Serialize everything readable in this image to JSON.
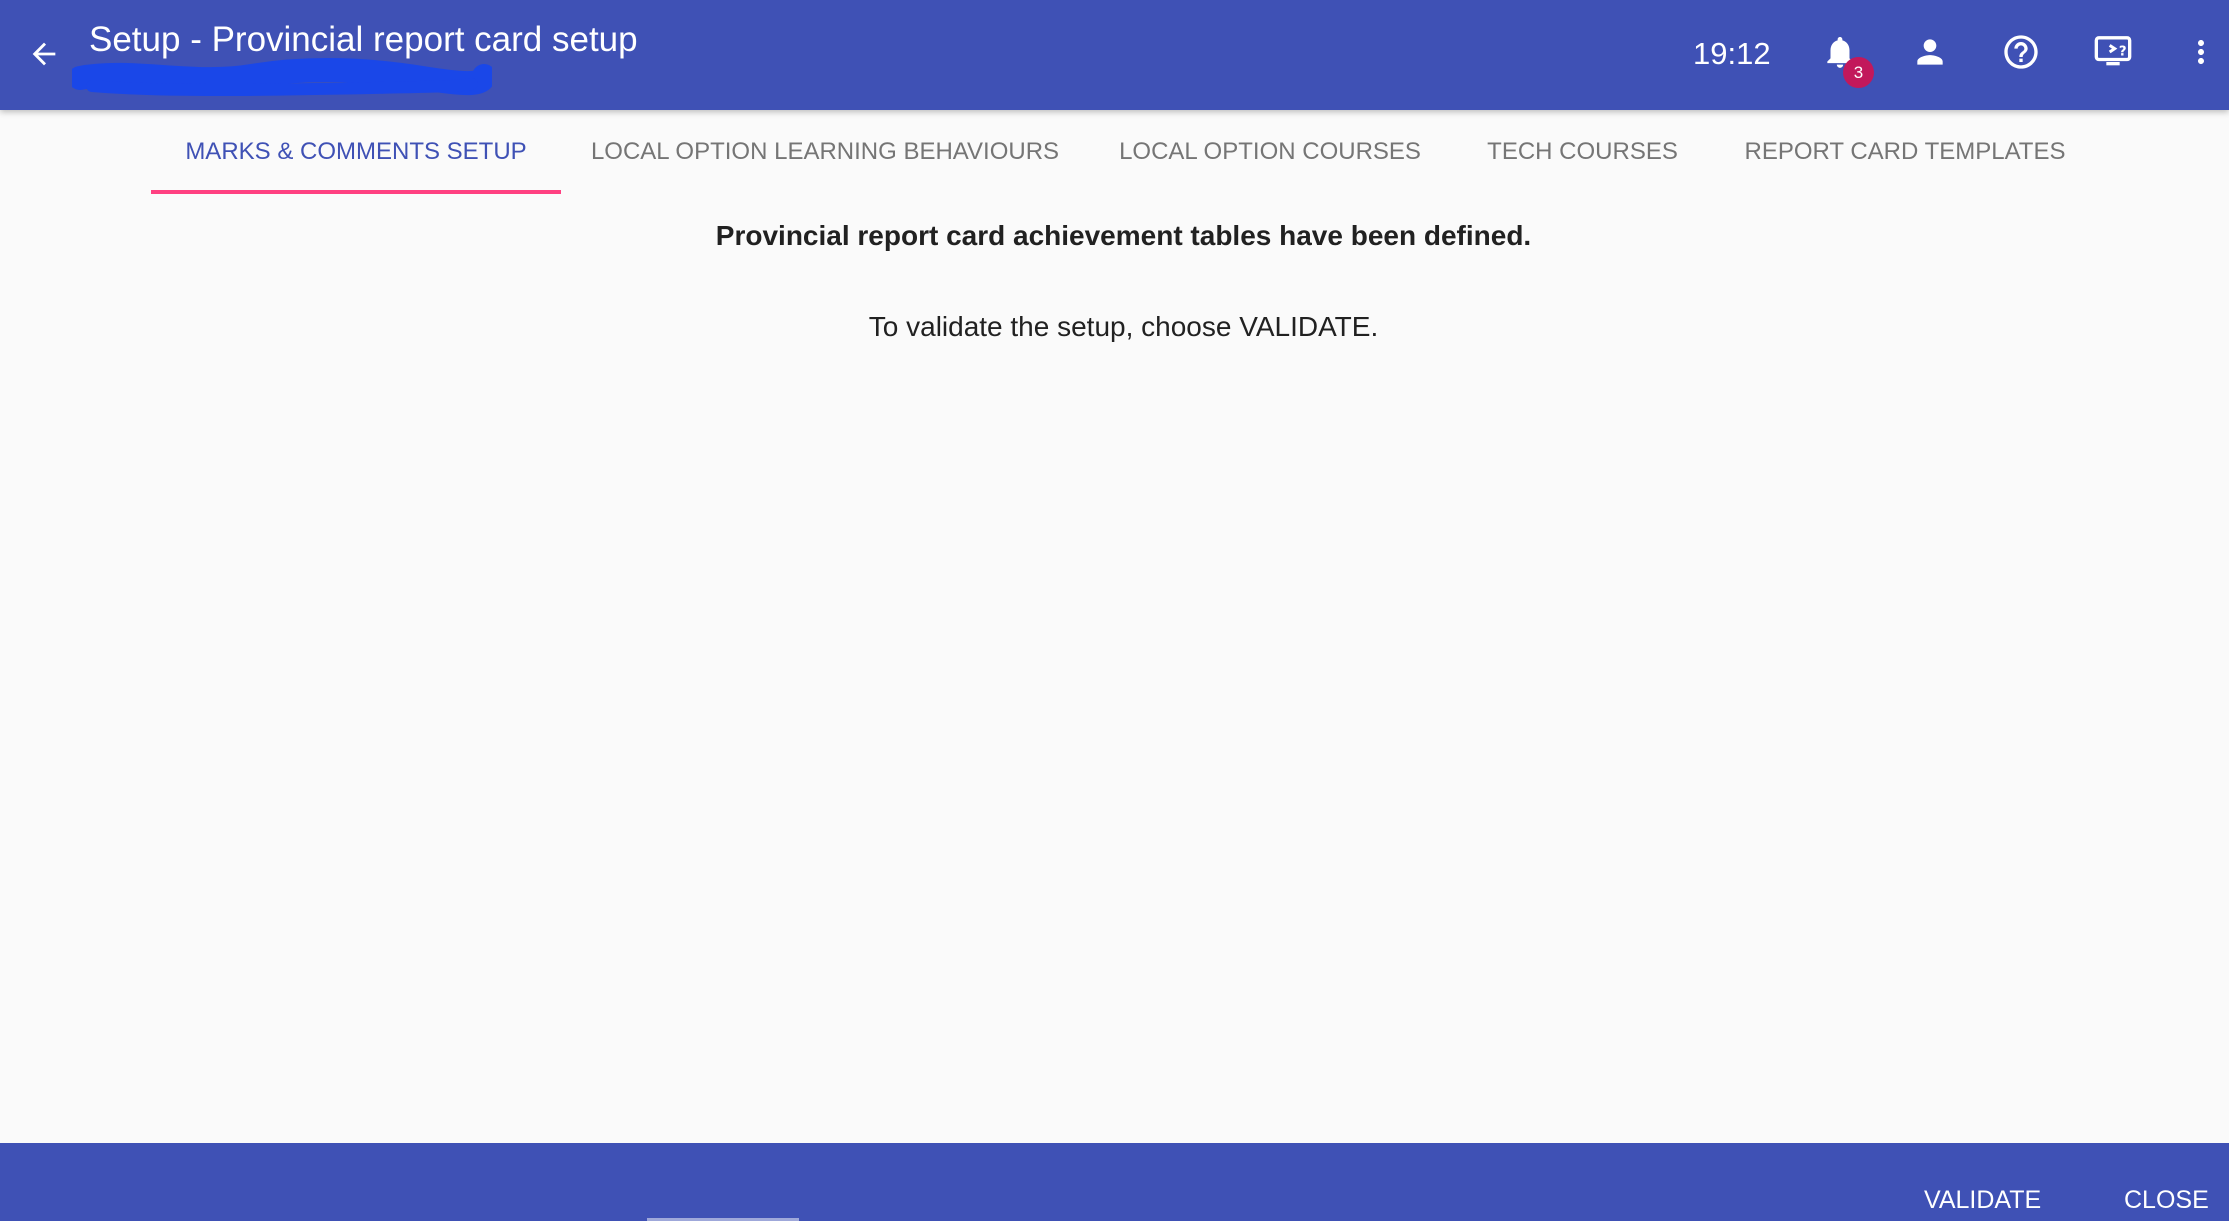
{
  "header": {
    "title": "Setup - Provincial report card setup",
    "time": "19:12",
    "notification_count": "3",
    "icons": [
      "back-arrow-icon",
      "bell-icon",
      "person-icon",
      "help-circle-icon",
      "monitor-help-icon",
      "more-vertical-icon"
    ]
  },
  "tabs": [
    {
      "label": "MARKS & COMMENTS SETUP",
      "active": true
    },
    {
      "label": "LOCAL OPTION LEARNING BEHAVIOURS",
      "active": false
    },
    {
      "label": "LOCAL OPTION COURSES",
      "active": false
    },
    {
      "label": "TECH COURSES",
      "active": false
    },
    {
      "label": "REPORT CARD TEMPLATES",
      "active": false
    }
  ],
  "content": {
    "heading": "Provincial report card achievement tables have been defined.",
    "instruction": "To validate the setup, choose VALIDATE."
  },
  "footer": {
    "validate_label": "VALIDATE",
    "close_label": "CLOSE"
  },
  "colors": {
    "primary": "#3f51b5",
    "accent": "#ff4081",
    "badge": "#c2185b",
    "background": "#fafafa"
  }
}
